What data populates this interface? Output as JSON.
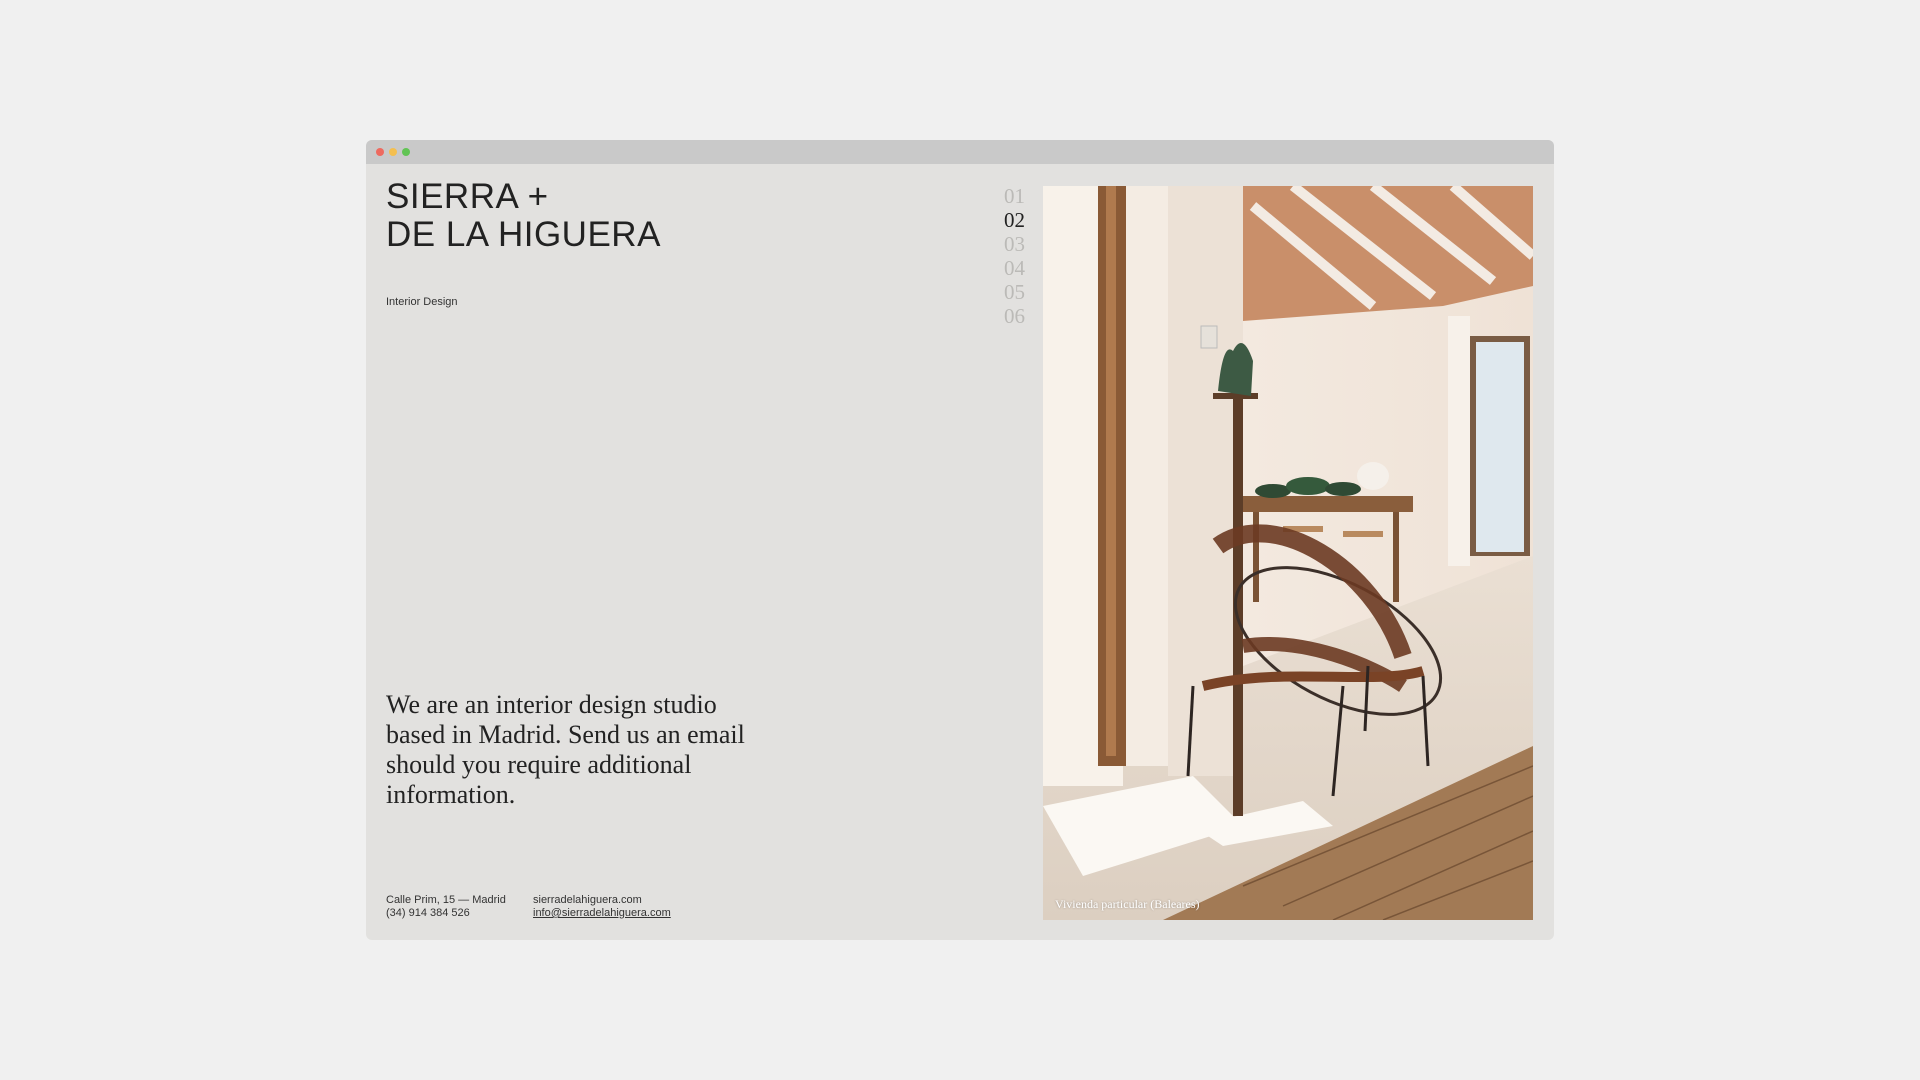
{
  "brand": {
    "line1": "SIERRA +",
    "line2": "DE LA HIGUERA",
    "tagline": "Interior Design"
  },
  "intro": "We are an interior design studio based in Madrid. Send us an email should you require additional information.",
  "contact": {
    "address": "Calle Prim, 15 — Madrid",
    "phone": "(34) 914 384 526",
    "website": "sierradelahiguera.com",
    "email": "info@sierradelahiguera.com"
  },
  "pager": {
    "items": [
      "01",
      "02",
      "03",
      "04",
      "05",
      "06"
    ],
    "active": "02"
  },
  "photo": {
    "caption": "Vivienda particular (Baleares)"
  },
  "colors": {
    "window_bg": "#e2e1df",
    "titlebar": "#c9c9c9",
    "traffic_red": "#ee6a5f",
    "traffic_yellow": "#f4bf50",
    "traffic_green": "#61c454",
    "pager_inactive": "#bbbab7",
    "text": "#222222"
  }
}
